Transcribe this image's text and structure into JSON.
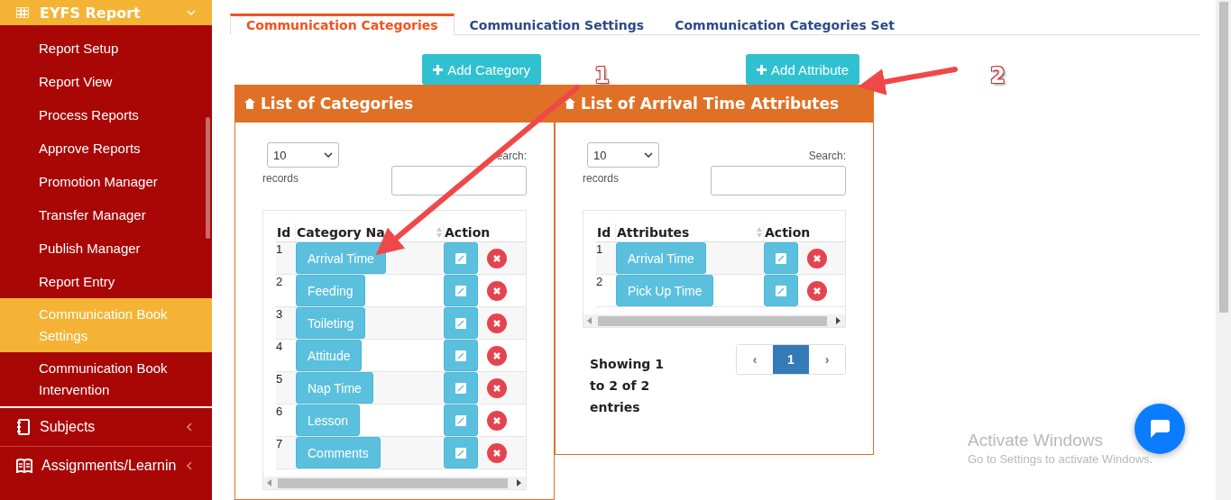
{
  "sidebar": {
    "section": {
      "label": "EYFS Report",
      "expanded": true
    },
    "items": [
      {
        "label": "Report Setup",
        "selected": false
      },
      {
        "label": "Report View",
        "selected": false
      },
      {
        "label": "Process Reports",
        "selected": false
      },
      {
        "label": "Approve Reports",
        "selected": false
      },
      {
        "label": "Promotion Manager",
        "selected": false
      },
      {
        "label": "Transfer Manager",
        "selected": false
      },
      {
        "label": "Publish Manager",
        "selected": false
      },
      {
        "label": "Report Entry",
        "selected": false
      },
      {
        "label": "Communication Book Settings",
        "selected": true
      },
      {
        "label": "Communication Book Intervention",
        "selected": false
      }
    ],
    "groups": [
      {
        "label": "Subjects",
        "kind": "notebook"
      },
      {
        "label": "Assignments/Learnin",
        "kind": "book"
      }
    ]
  },
  "tabs": [
    {
      "label": "Communication Categories",
      "selected": true
    },
    {
      "label": "Communication Settings",
      "selected": false
    },
    {
      "label": "Communication Categories Set",
      "selected": false
    }
  ],
  "panels": [
    {
      "button": "Add Category",
      "title": "List of Categories",
      "length": "10",
      "records_label": "records",
      "search_label": "earch:",
      "columns": [
        "Id",
        "Category Na",
        "Action"
      ],
      "rows": [
        {
          "id": "1",
          "name": "Arrival Time"
        },
        {
          "id": "2",
          "name": "Feeding"
        },
        {
          "id": "3",
          "name": "Toileting"
        },
        {
          "id": "4",
          "name": "Attitude"
        },
        {
          "id": "5",
          "name": "Nap Time"
        },
        {
          "id": "6",
          "name": "Lesson"
        },
        {
          "id": "7",
          "name": "Comments"
        }
      ]
    },
    {
      "button": "Add Attribute",
      "title": "List of Arrival Time Attributes",
      "length": "10",
      "records_label": "records",
      "search_label": "Search:",
      "columns": [
        "Id",
        "Attributes",
        "Action"
      ],
      "rows": [
        {
          "id": "1",
          "name": "Arrival Time"
        },
        {
          "id": "2",
          "name": "Pick Up Time"
        }
      ],
      "info": "Showing 1 to 2 of 2 entries",
      "pagination": {
        "prev": "‹",
        "pages": [
          {
            "label": "1",
            "selected": true
          }
        ],
        "next": "›"
      }
    }
  ],
  "annotations": [
    {
      "label": "1"
    },
    {
      "label": "2"
    }
  ],
  "watermark": {
    "title": "Activate Windows",
    "subtitle": "Go to Settings to activate Windows."
  }
}
